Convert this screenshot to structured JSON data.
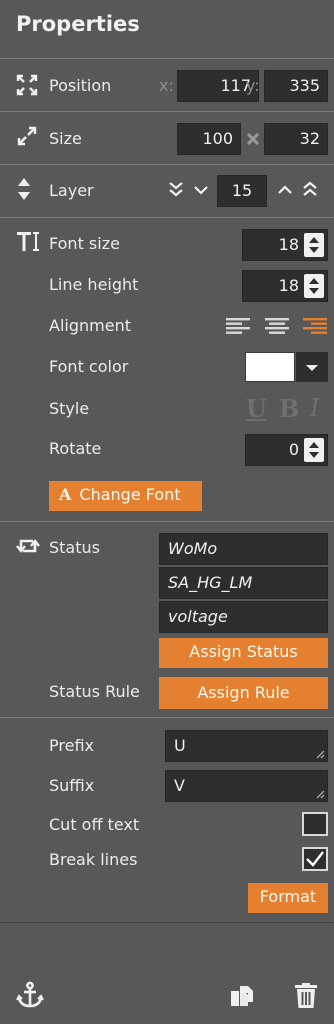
{
  "panel": {
    "title": "Properties"
  },
  "position": {
    "label": "Position",
    "x_label": "x:",
    "x": "117",
    "y_label": "y:",
    "y": "335"
  },
  "size": {
    "label": "Size",
    "width": "100",
    "height": "32"
  },
  "layer": {
    "label": "Layer",
    "value": "15"
  },
  "font": {
    "size_label": "Font size",
    "size": "18",
    "line_height_label": "Line height",
    "line_height": "18",
    "alignment_label": "Alignment",
    "alignment_selected": "right",
    "color_label": "Font color",
    "color": "#ffffff",
    "style_label": "Style",
    "style_underline": "U",
    "style_bold": "B",
    "style_italic": "I",
    "rotate_label": "Rotate",
    "rotate": "0",
    "change_font_glyph": "A",
    "change_font_label": "Change Font"
  },
  "status": {
    "label": "Status",
    "items": [
      "WoMo",
      "SA_HG_LM",
      "voltage"
    ],
    "assign_label": "Assign Status",
    "rule_label": "Status Rule",
    "assign_rule_label": "Assign Rule"
  },
  "text": {
    "prefix_label": "Prefix",
    "prefix": "U",
    "suffix_label": "Suffix",
    "suffix": "V",
    "cutoff_label": "Cut off text",
    "cutoff": false,
    "breaklines_label": "Break lines",
    "breaklines": true,
    "format_label": "Format"
  },
  "colors": {
    "accent": "#e58030",
    "panel": "#585858",
    "field": "#2e2e2e"
  }
}
